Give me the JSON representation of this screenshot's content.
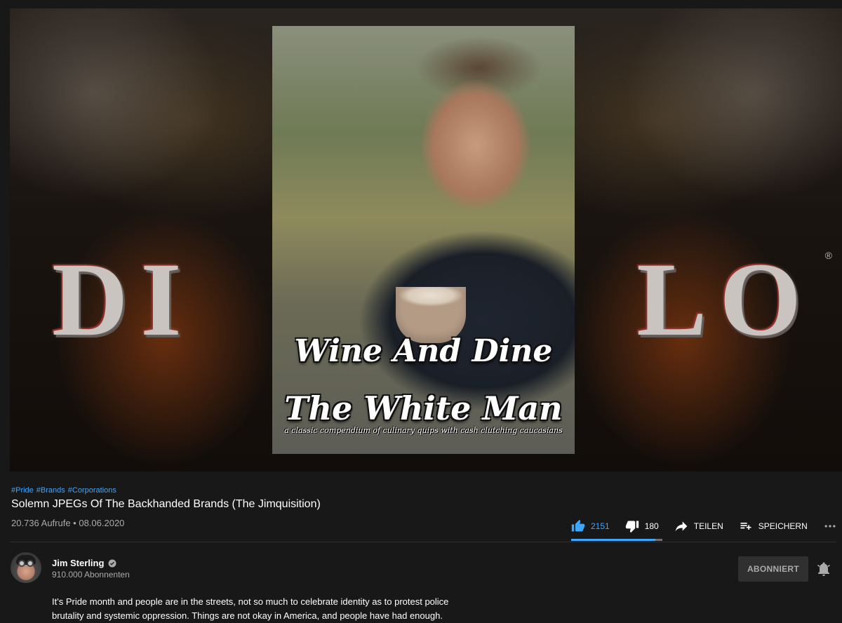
{
  "player": {
    "background_letters_left": "DI",
    "background_letters_right": "LO",
    "trademark": "®",
    "poster": {
      "title_line1": "Wine And Dine",
      "title_line2": "The White Man",
      "tagline": "a classic compendium of culinary quips with cash clutching caucasians"
    }
  },
  "video": {
    "hashtags": [
      "#Pride",
      "#Brands",
      "#Corporations"
    ],
    "title": "Solemn JPEGs Of The Backhanded Brands (The Jimquisition)",
    "meta": "20.736 Aufrufe • 08.06.2020"
  },
  "actions": {
    "like_count": "2151",
    "dislike_count": "180",
    "share_label": "TEILEN",
    "save_label": "SPEICHERN",
    "like_ratio": 0.923,
    "colors": {
      "like_active": "#3ea6ff",
      "bar_bg": "#717171"
    }
  },
  "channel": {
    "name": "Jim Sterling",
    "subscribers": "910.000 Abonnenten",
    "subscribe_label": "ABONNIERT"
  },
  "description": {
    "line1": "It's Pride month and people are in the streets, not so much to celebrate identity as to protest police",
    "line2": "brutality and systemic oppression. Things are not okay in America, and people have had enough."
  },
  "icons": {
    "like": "thumbs-up-icon",
    "dislike": "thumbs-down-icon",
    "share": "share-arrow-icon",
    "save": "playlist-add-icon",
    "more": "more-dots-icon",
    "verified": "verified-check-icon",
    "bell": "bell-icon"
  }
}
